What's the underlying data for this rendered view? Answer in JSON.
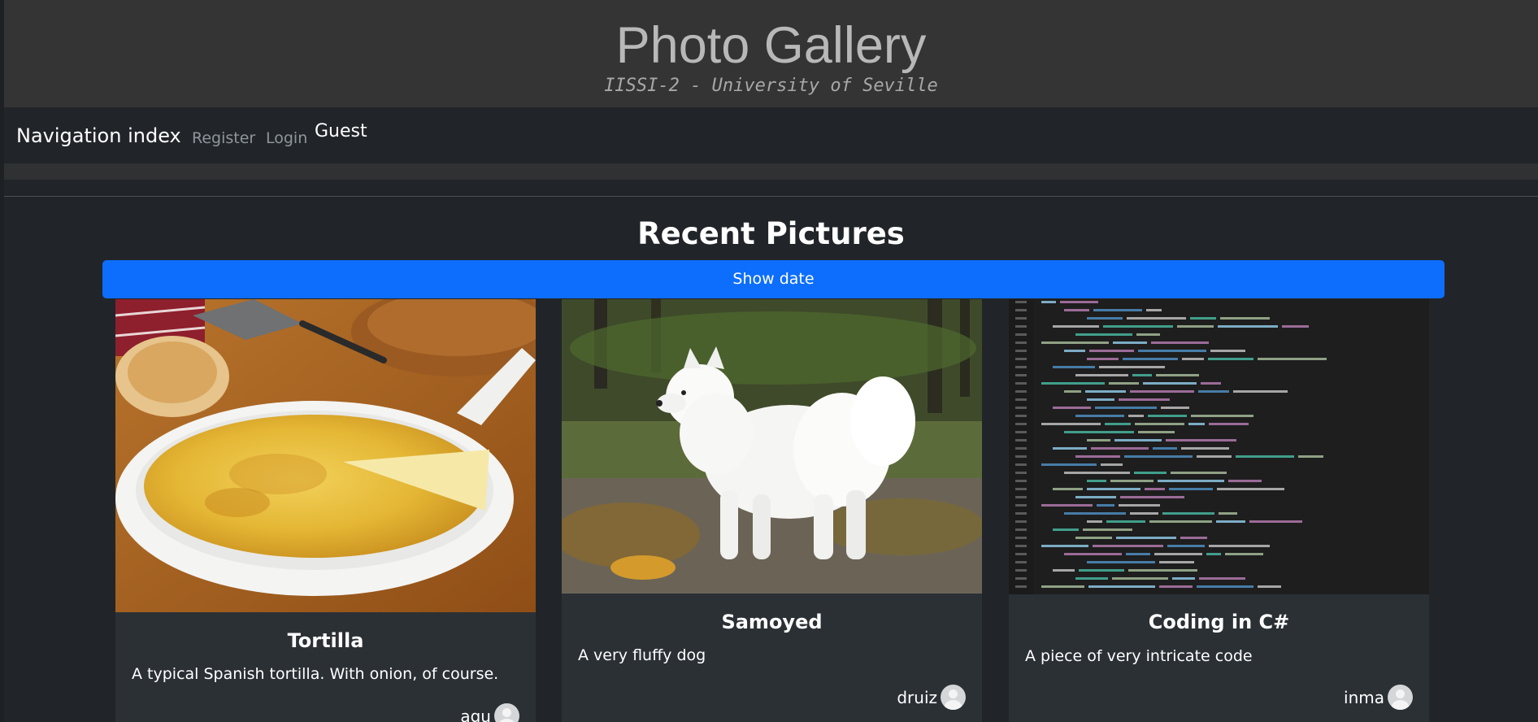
{
  "header": {
    "title": "Photo Gallery",
    "subtitle": "IISSI-2 - University of Seville"
  },
  "nav": {
    "brand": "Navigation index",
    "register": "Register",
    "login": "Login",
    "user": "Guest"
  },
  "main": {
    "section_title": "Recent Pictures",
    "show_date_label": "Show date"
  },
  "cards": [
    {
      "title": "Tortilla",
      "description": "A typical Spanish tortilla. With onion, of course.",
      "user": "agu",
      "image": "tortilla-photo"
    },
    {
      "title": "Samoyed",
      "description": "A very fluffy dog",
      "user": "druiz",
      "image": "samoyed-photo"
    },
    {
      "title": "Coding in C#",
      "description": "A piece of very intricate code",
      "user": "inma",
      "image": "code-screenshot"
    }
  ],
  "colors": {
    "header_bg": "#343434",
    "navbar_bg": "#212529",
    "primary": "#0d6efd",
    "card_bg": "#2b3035"
  }
}
